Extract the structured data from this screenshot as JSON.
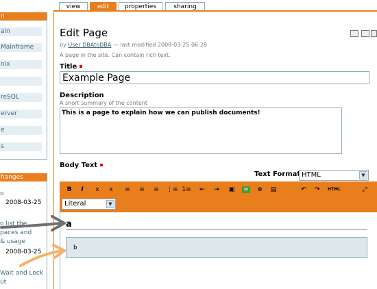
{
  "sidebar": {
    "nav_header": "n",
    "nav_items": [
      "ain",
      "Mainframe",
      "nix",
      "",
      "reSQL",
      "erver",
      "e",
      "s"
    ],
    "recent_header": "hanges",
    "recent_items": [
      {
        "title": "o",
        "date": "2008-03-25"
      },
      {
        "title": "o list the\npaces and\n& usage",
        "date": "2008-03-25"
      },
      {
        "title": "Wait and Lock\nut",
        "date": ""
      }
    ]
  },
  "tabs": [
    {
      "label": "view",
      "active": false
    },
    {
      "label": "edit",
      "active": true
    },
    {
      "label": "properties",
      "active": false
    },
    {
      "label": "sharing",
      "active": false
    }
  ],
  "page": {
    "title": "Edit Page",
    "byline_prefix": "by ",
    "author": "User DBAtoDBA",
    "byline_suffix": " — last modified 2008-03-25 06:28",
    "description": "A page in the site. Can contain rich text."
  },
  "fields": {
    "title_label": "Title",
    "title_value": "Example Page",
    "description_label": "Description",
    "description_help": "A short summary of the content",
    "description_value": "This is a page to explain how we can publish documents!",
    "body_label": "Body Text",
    "text_format_label": "Text Format",
    "text_format_value": "HTML"
  },
  "editor": {
    "toolbar_buttons": [
      "B",
      "I",
      "x",
      "x",
      "≡",
      "≡",
      "≡",
      "⋮≡",
      "1≡",
      "⇤",
      "⇥",
      "▣",
      "∞",
      "⊕",
      "▤",
      "↶",
      "↷",
      "HTML",
      "⤢"
    ],
    "style_value": "Literal",
    "heading_text": "a",
    "pre_text": "b"
  },
  "colors": {
    "accent": "#e97e1c",
    "link": "#436976",
    "border": "#8cacbb",
    "pre_bg": "#dee7ec"
  }
}
